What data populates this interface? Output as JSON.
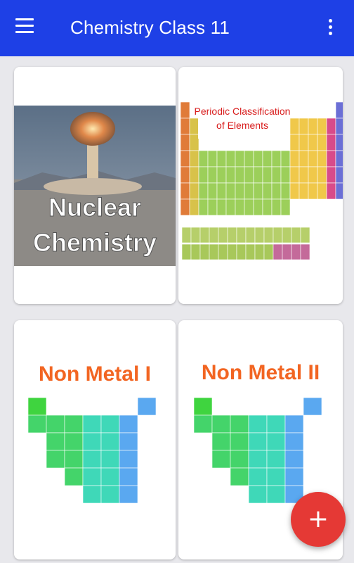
{
  "appbar": {
    "title": "Chemistry Class 11",
    "menu_icon": "hamburger-menu-icon",
    "overflow_icon": "more-vertical-icon",
    "color": "#1e40e6"
  },
  "cards": [
    {
      "image_text_line1": "Nuclear",
      "image_text_line2": "Chemistry"
    },
    {
      "image_title_line1": "Periodic Classification",
      "image_title_line2": "of Elements"
    },
    {
      "image_title": "Non Metal I"
    },
    {
      "image_title": "Non Metal II"
    }
  ],
  "fab": {
    "icon": "add-icon",
    "label": "+",
    "color": "#e53935"
  }
}
